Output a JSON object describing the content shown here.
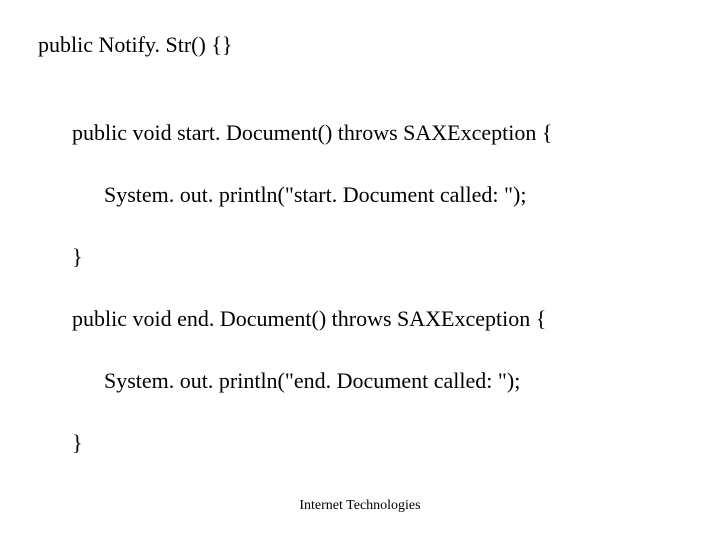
{
  "code": {
    "line1": "public Notify. Str() {}",
    "line2": "public void start. Document() throws SAXException {",
    "line3": "System. out. println(\"start. Document called: \");",
    "line4": "}",
    "line5": "public void end. Document() throws SAXException {",
    "line6": "System. out. println(\"end. Document called: \");",
    "line7": "}"
  },
  "footer": "Internet Technologies"
}
